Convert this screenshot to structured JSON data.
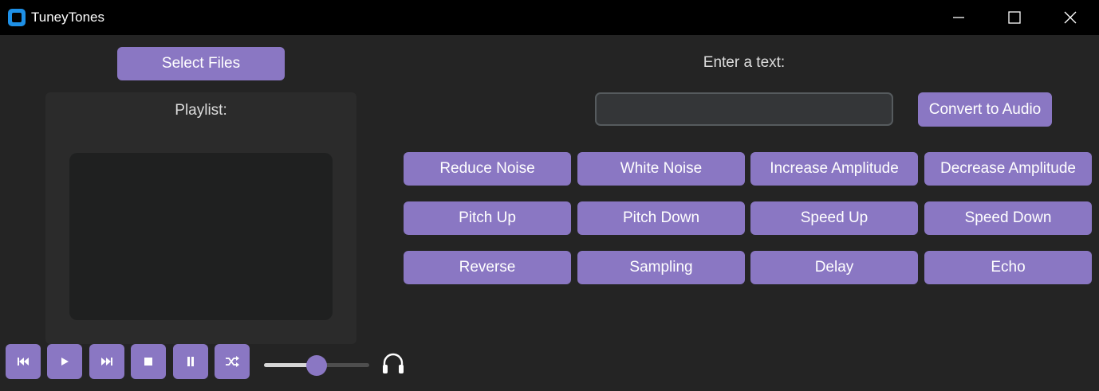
{
  "window": {
    "title": "TuneyTones",
    "controls": [
      "minimize-icon",
      "maximize-icon",
      "close-icon"
    ]
  },
  "left": {
    "select_files_label": "Select Files",
    "playlist_label": "Playlist:"
  },
  "text_to_audio": {
    "label": "Enter a text:",
    "input_value": "",
    "convert_label": "Convert to Audio"
  },
  "effects": {
    "row1": [
      "Reduce Noise",
      "White Noise",
      "Increase Amplitude",
      "Decrease Amplitude"
    ],
    "row2": [
      "Pitch Up",
      "Pitch Down",
      "Speed Up",
      "Speed Down"
    ],
    "row3": [
      "Reverse",
      "Sampling",
      "Delay",
      "Echo"
    ]
  },
  "playback": {
    "controls": [
      "previous-icon",
      "play-icon",
      "next-icon",
      "stop-icon",
      "pause-icon",
      "shuffle-icon"
    ],
    "volume_fraction": 0.5,
    "volume_icon": "headphones-icon"
  },
  "colors": {
    "accent": "#8a77c3",
    "background": "#242424",
    "panel": "#2b2b2b",
    "titlebar": "#000000",
    "app_icon": "#1e90e6"
  }
}
